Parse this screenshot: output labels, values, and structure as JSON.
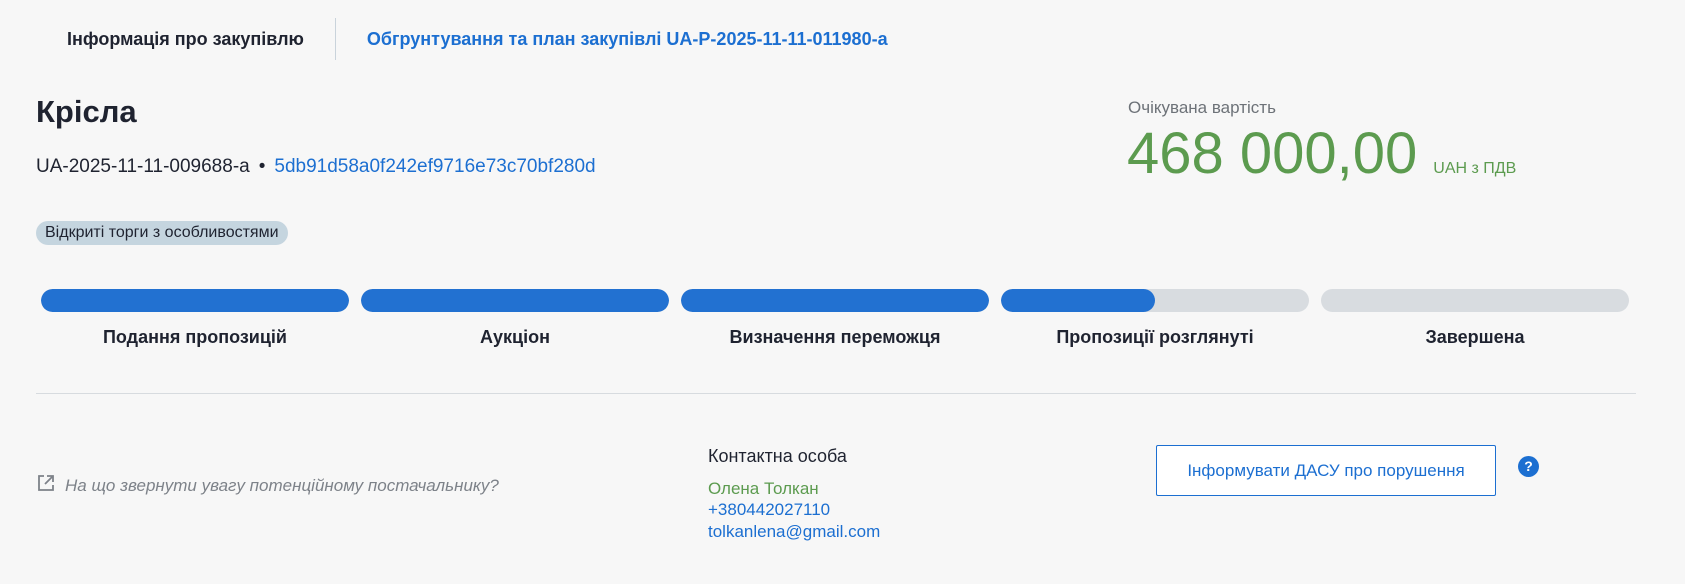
{
  "tabs": {
    "info": "Інформація про закупівлю",
    "plan": "Обгрунтування та план закупівлі UA-P-2025-11-11-011980-a"
  },
  "tender": {
    "title": "Крісла",
    "id": "UA-2025-11-11-009688-a",
    "separator": "•",
    "hash": "5db91d58a0f242ef9716e73c70bf280d",
    "procedure_type": "Відкриті торги з особливостями"
  },
  "price": {
    "label": "Очікувана вартість",
    "amount": "468 000,00",
    "unit": "UAH з ПДВ"
  },
  "steps": [
    {
      "label": "Подання пропозицій",
      "progress": 1.0
    },
    {
      "label": "Аукціон",
      "progress": 1.0
    },
    {
      "label": "Визначення переможця",
      "progress": 1.0
    },
    {
      "label": "Пропозиції розглянуті",
      "progress": 0.5
    },
    {
      "label": "Завершена",
      "progress": 0.0
    }
  ],
  "hint": {
    "text": "На що звернути увагу потенційному постачальнику?",
    "icon": "external-link-icon"
  },
  "contact": {
    "label": "Контактна особа",
    "name": "Олена Толкан",
    "phone": "+380442027110",
    "email": "tolkanlena@gmail.com"
  },
  "report_button": "Інформувати ДАСУ про порушення",
  "help_icon": "?",
  "colors": {
    "accent_blue": "#1c6fd1",
    "price_green": "#5c9b4f",
    "badge_bg": "#c5d5df",
    "progress_fill": "#2271d1",
    "progress_track": "#d8dce0"
  }
}
